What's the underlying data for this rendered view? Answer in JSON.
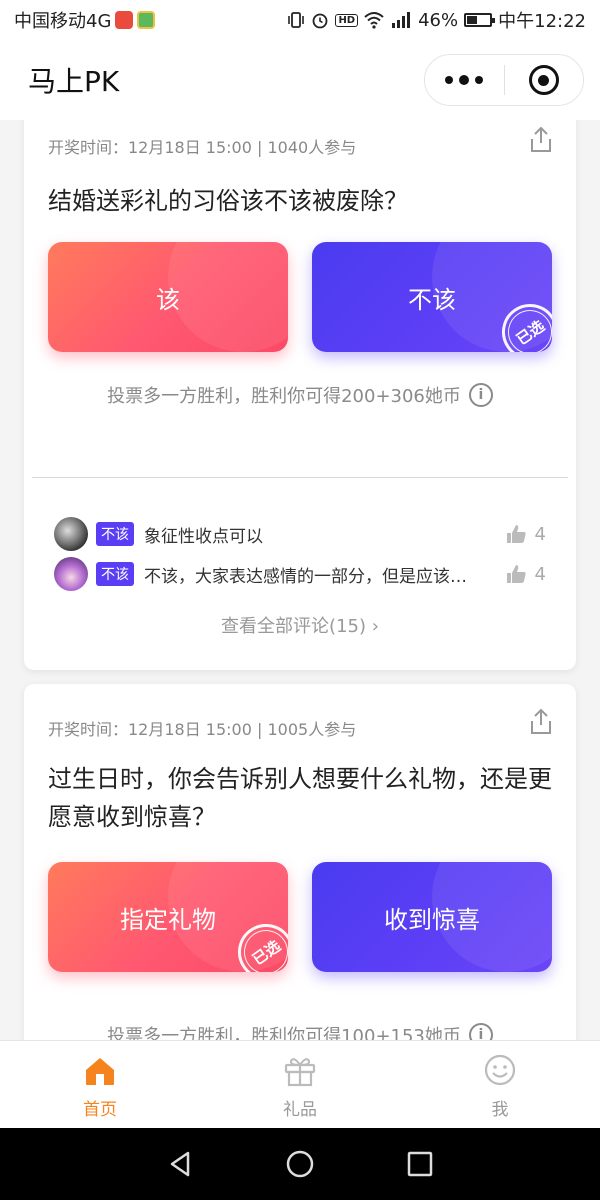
{
  "status_bar": {
    "carrier": "中国移动4G",
    "battery_percent": "46%",
    "time": "中午12:22",
    "battery_level": 0.46
  },
  "header": {
    "title": "马上PK"
  },
  "feed": [
    {
      "meta": "开奖时间：12月18日 15:00 | 1040人参与",
      "question": "结婚送彩礼的习俗该不该被废除？",
      "option_left": "该",
      "option_right": "不该",
      "selected_stamp": "已选",
      "reward": "投票多一方胜利，胜利你可得200+306她币",
      "comments": [
        {
          "tag": "不该",
          "text": "象征性收点可以",
          "likes": "4"
        },
        {
          "tag": "不该",
          "text": "不该，大家表达感情的一部分，但是应该…",
          "likes": "4"
        }
      ],
      "view_all": "查看全部评论(15)"
    },
    {
      "meta": "开奖时间：12月18日 15:00 | 1005人参与",
      "question": "过生日时，你会告诉别人想要什么礼物，还是更愿意收到惊喜？",
      "option_left": "指定礼物",
      "option_right": "收到惊喜",
      "selected_stamp": "已选",
      "reward": "投票多一方胜利，胜利你可得100+153她币"
    }
  ],
  "tabs": [
    {
      "label": "首页",
      "icon": "home-icon",
      "active": true
    },
    {
      "label": "礼品",
      "icon": "gift-icon",
      "active": false
    },
    {
      "label": "我",
      "icon": "smile-icon",
      "active": false
    }
  ],
  "colors": {
    "accent": "#f5841f",
    "option_left": "#fb5a6a",
    "option_right": "#5a3ef5"
  }
}
